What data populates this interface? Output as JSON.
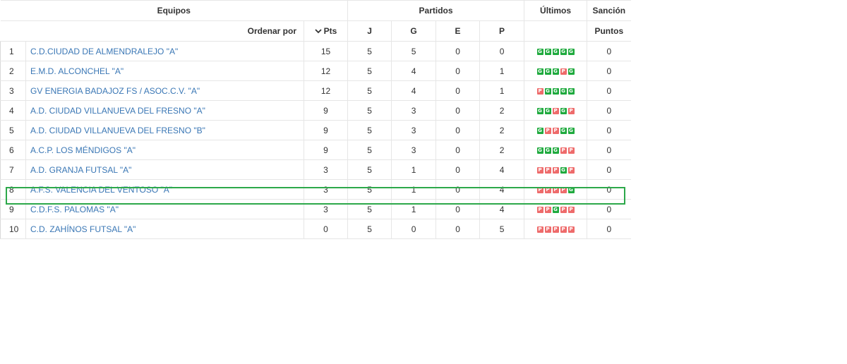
{
  "headers": {
    "equipos": "Equipos",
    "partidos": "Partidos",
    "ultimos": "Últimos",
    "sancion": "Sanción",
    "ordenar_por": "Ordenar por",
    "pts": "Pts",
    "j": "J",
    "g": "G",
    "e": "E",
    "p": "P",
    "puntos": "Puntos"
  },
  "icons": {
    "sort": "chevron-down-icon"
  },
  "colors": {
    "link": "#3a77b5",
    "win": "#1faa3e",
    "loss": "#ee6b6b",
    "highlight": "#2ca84a"
  },
  "highlighted_position": "8",
  "rows": [
    {
      "pos": "1",
      "team": "C.D.CIUDAD DE ALMENDRALEJO \"A\"",
      "pts": "15",
      "j": "5",
      "g": "5",
      "e": "0",
      "p": "0",
      "last": [
        "G",
        "G",
        "G",
        "G",
        "G"
      ],
      "sancion": "0"
    },
    {
      "pos": "2",
      "team": "E.M.D. ALCONCHEL \"A\"",
      "pts": "12",
      "j": "5",
      "g": "4",
      "e": "0",
      "p": "1",
      "last": [
        "G",
        "G",
        "G",
        "P",
        "G"
      ],
      "sancion": "0"
    },
    {
      "pos": "3",
      "team": "GV ENERGIA BADAJOZ FS / ASOC.C.V. \"A\"",
      "pts": "12",
      "j": "5",
      "g": "4",
      "e": "0",
      "p": "1",
      "last": [
        "P",
        "G",
        "G",
        "G",
        "G"
      ],
      "sancion": "0"
    },
    {
      "pos": "4",
      "team": "A.D. CIUDAD VILLANUEVA DEL FRESNO \"A\"",
      "pts": "9",
      "j": "5",
      "g": "3",
      "e": "0",
      "p": "2",
      "last": [
        "G",
        "G",
        "P",
        "G",
        "P"
      ],
      "sancion": "0"
    },
    {
      "pos": "5",
      "team": "A.D. CIUDAD VILLANUEVA DEL FRESNO \"B\"",
      "pts": "9",
      "j": "5",
      "g": "3",
      "e": "0",
      "p": "2",
      "last": [
        "G",
        "P",
        "P",
        "G",
        "G"
      ],
      "sancion": "0"
    },
    {
      "pos": "6",
      "team": "A.C.P. LOS MÉNDIGOS \"A\"",
      "pts": "9",
      "j": "5",
      "g": "3",
      "e": "0",
      "p": "2",
      "last": [
        "G",
        "G",
        "G",
        "P",
        "P"
      ],
      "sancion": "0"
    },
    {
      "pos": "7",
      "team": "A.D. GRANJA FUTSAL \"A\"",
      "pts": "3",
      "j": "5",
      "g": "1",
      "e": "0",
      "p": "4",
      "last": [
        "P",
        "P",
        "P",
        "G",
        "P"
      ],
      "sancion": "0"
    },
    {
      "pos": "8",
      "team": "A.F.S. VALENCIA DEL VENTOSO \"A\"",
      "pts": "3",
      "j": "5",
      "g": "1",
      "e": "0",
      "p": "4",
      "last": [
        "P",
        "P",
        "P",
        "P",
        "G"
      ],
      "sancion": "0"
    },
    {
      "pos": "9",
      "team": "C.D.F.S. PALOMAS \"A\"",
      "pts": "3",
      "j": "5",
      "g": "1",
      "e": "0",
      "p": "4",
      "last": [
        "P",
        "P",
        "G",
        "P",
        "P"
      ],
      "sancion": "0"
    },
    {
      "pos": "10",
      "team": "C.D. ZAHÍNOS FUTSAL \"A\"",
      "pts": "0",
      "j": "5",
      "g": "0",
      "e": "0",
      "p": "5",
      "last": [
        "P",
        "P",
        "P",
        "P",
        "P"
      ],
      "sancion": "0"
    }
  ]
}
